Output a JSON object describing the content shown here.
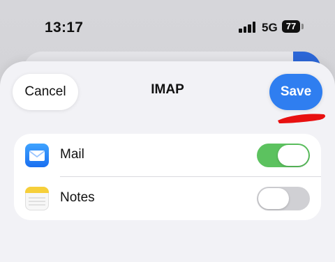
{
  "status_bar": {
    "time": "13:17",
    "network": "5G",
    "battery": "77"
  },
  "sheet": {
    "title": "IMAP",
    "cancel_label": "Cancel",
    "save_label": "Save"
  },
  "sync_items": [
    {
      "label": "Mail",
      "icon": "mail-icon",
      "enabled": true
    },
    {
      "label": "Notes",
      "icon": "notes-icon",
      "enabled": false
    }
  ],
  "colors": {
    "accent": "#2f7ef0",
    "toggle_on": "#5cc25f",
    "toggle_off": "#d0d0d4",
    "annotation": "#e81010"
  }
}
